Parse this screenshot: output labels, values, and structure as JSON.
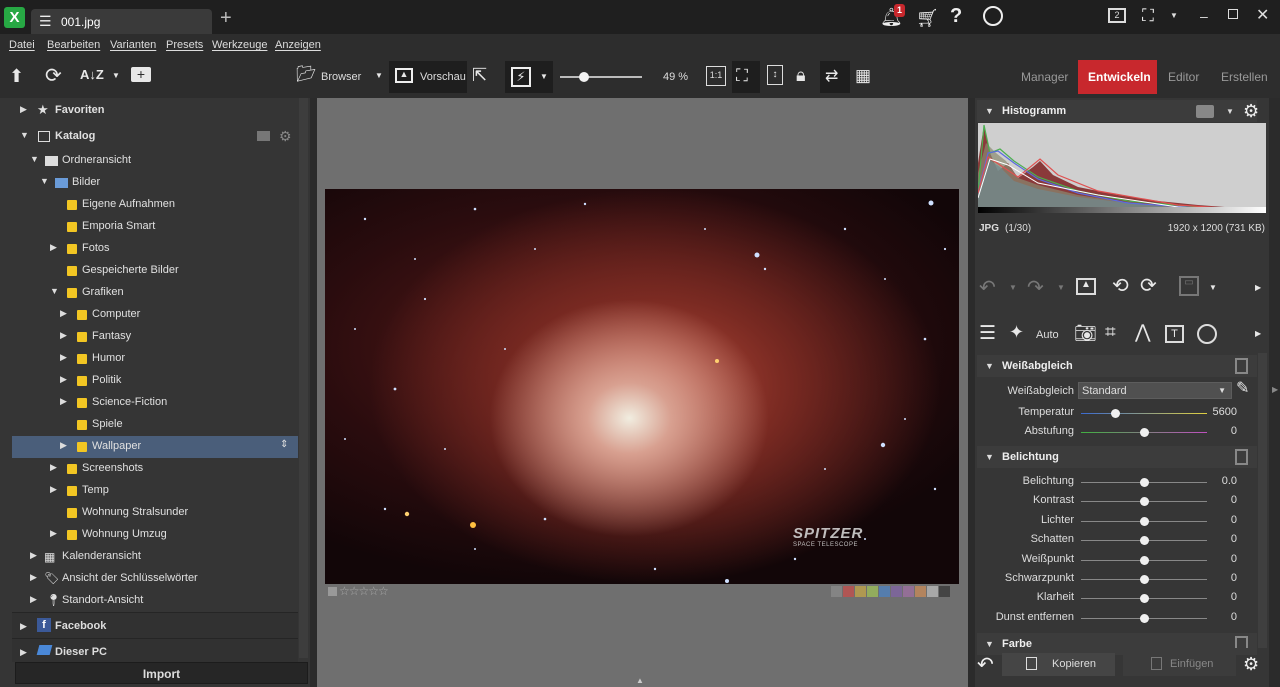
{
  "titlebar": {
    "tab_label": "001.jpg",
    "notification_count": "1",
    "help_label": "?",
    "screen_number": "2"
  },
  "menu": [
    "Datei",
    "Bearbeiten",
    "Varianten",
    "Presets",
    "Werkzeuge",
    "Anzeigen"
  ],
  "toolbar": {
    "browser_label": "Browser",
    "preview_label": "Vorschau",
    "zoom_value": "49 %",
    "one_to_one_label": "1:1",
    "sort_label": "A↓Z",
    "mode_tabs": [
      "Manager",
      "Entwickeln",
      "Editor",
      "Erstellen"
    ],
    "active_mode": "Entwickeln",
    "accent_color": "#c8282d"
  },
  "sidebar": {
    "favorites": "Favoriten",
    "catalog": "Katalog",
    "folder_view": "Ordneransicht",
    "pictures": "Bilder",
    "items": [
      {
        "label": "Eigene Aufnahmen",
        "level": 3,
        "arrow": ""
      },
      {
        "label": "Emporia Smart",
        "level": 3,
        "arrow": ""
      },
      {
        "label": "Fotos",
        "level": 3,
        "arrow": "▶"
      },
      {
        "label": "Gespeicherte Bilder",
        "level": 3,
        "arrow": ""
      },
      {
        "label": "Grafiken",
        "level": 3,
        "arrow": "▼"
      },
      {
        "label": "Computer",
        "level": 4,
        "arrow": "▶"
      },
      {
        "label": "Fantasy",
        "level": 4,
        "arrow": "▶"
      },
      {
        "label": "Humor",
        "level": 4,
        "arrow": "▶"
      },
      {
        "label": "Politik",
        "level": 4,
        "arrow": "▶"
      },
      {
        "label": "Science-Fiction",
        "level": 4,
        "arrow": "▶"
      },
      {
        "label": "Spiele",
        "level": 4,
        "arrow": ""
      },
      {
        "label": "Wallpaper",
        "level": 4,
        "arrow": "▶",
        "selected": true
      },
      {
        "label": "Screenshots",
        "level": 3,
        "arrow": "▶"
      },
      {
        "label": "Temp",
        "level": 3,
        "arrow": "▶"
      },
      {
        "label": "Wohnung Stralsunder",
        "level": 3,
        "arrow": ""
      },
      {
        "label": "Wohnung Umzug",
        "level": 3,
        "arrow": "▶"
      }
    ],
    "calendar_view": "Kalenderansicht",
    "keywords_view": "Ansicht der Schlüsselwörter",
    "location_view": "Standort-Ansicht",
    "facebook": "Facebook",
    "this_pc": "Dieser PC",
    "import_button": "Import"
  },
  "viewer": {
    "rating_stars": "☆☆☆☆☆",
    "watermark_line1": "SPITZER",
    "watermark_line2": "SPACE TELESCOPE",
    "color_labels": [
      "#8a8a8a",
      "#c0504d",
      "#bfa34a",
      "#9bbb59",
      "#4f81bd",
      "#8064a2",
      "#9c6fa0",
      "#c48a5a",
      "#b7b7b7",
      "#3a3a3a"
    ]
  },
  "histogram": {
    "title": "Histogramm",
    "file_type": "JPG",
    "index": "(1/30)",
    "dimensions": "1920 x 1200 (731 KB)"
  },
  "develop": {
    "auto_label": "Auto",
    "white_balance_title": "Weißabgleich",
    "white_balance_label": "Weißabgleich",
    "white_balance_value": "Standard",
    "wb_sliders": [
      {
        "label": "Temperatur",
        "value": "5600",
        "pos": 0.27
      },
      {
        "label": "Abstufung",
        "value": "0",
        "pos": 0.5
      }
    ],
    "exposure_title": "Belichtung",
    "exposure_sliders": [
      {
        "label": "Belichtung",
        "value": "0.0",
        "pos": 0.5
      },
      {
        "label": "Kontrast",
        "value": "0",
        "pos": 0.5
      },
      {
        "label": "Lichter",
        "value": "0",
        "pos": 0.5
      },
      {
        "label": "Schatten",
        "value": "0",
        "pos": 0.5
      },
      {
        "label": "Weißpunkt",
        "value": "0",
        "pos": 0.5
      },
      {
        "label": "Schwarzpunkt",
        "value": "0",
        "pos": 0.5
      },
      {
        "label": "Klarheit",
        "value": "0",
        "pos": 0.5
      },
      {
        "label": "Dunst entfernen",
        "value": "0",
        "pos": 0.5
      }
    ],
    "color_title": "Farbe",
    "copy_button": "Kopieren",
    "paste_button": "Einfügen"
  }
}
